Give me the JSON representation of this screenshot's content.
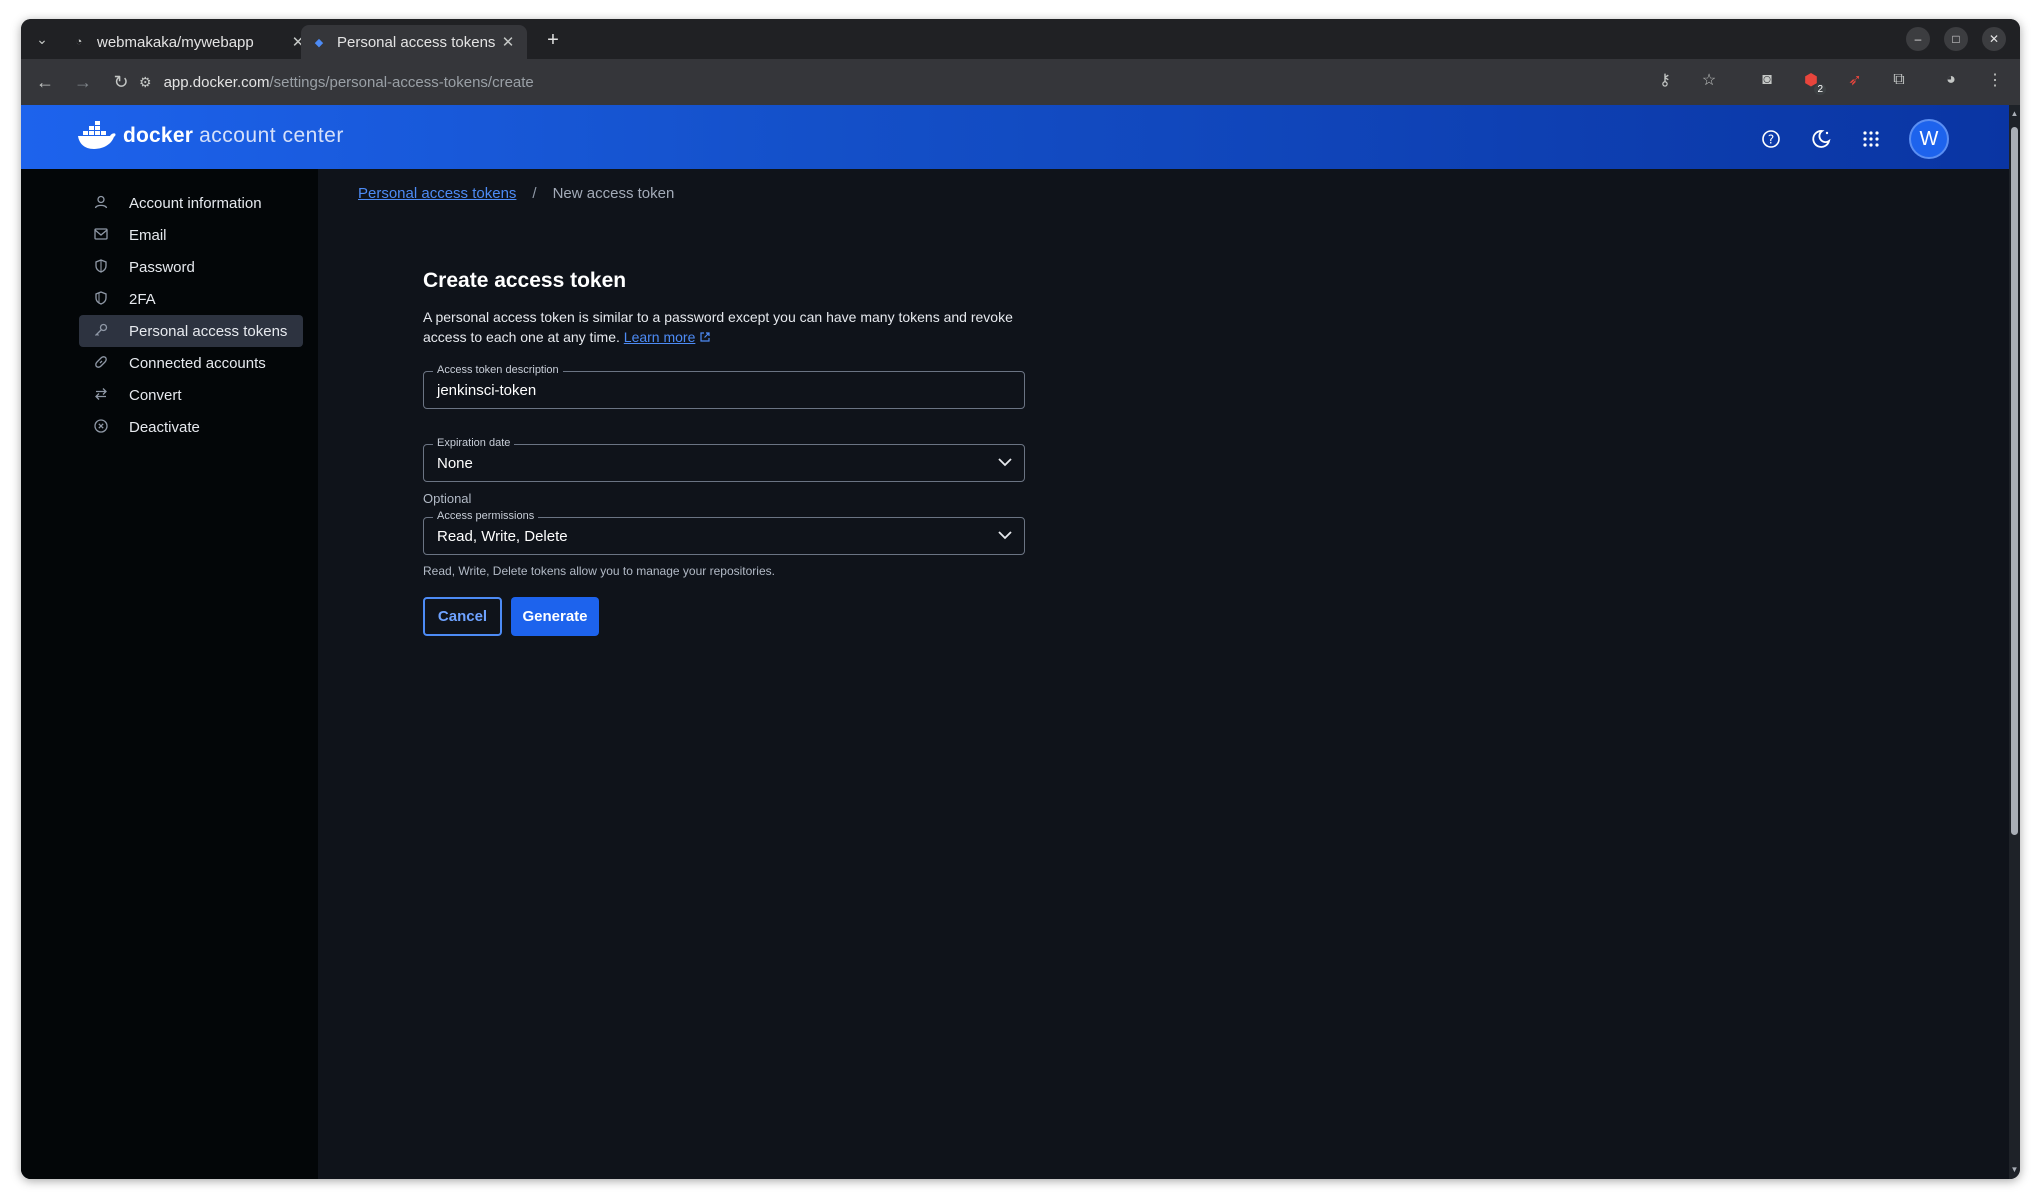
{
  "browser": {
    "tabs": [
      {
        "title": "webmakaka/mywebapp",
        "active": false
      },
      {
        "title": "Personal access tokens |",
        "active": true
      }
    ],
    "url_host": "app.docker.com",
    "url_path": "/settings/personal-access-tokens/create",
    "extension_badge": "2"
  },
  "header": {
    "brand_primary": "docker",
    "brand_secondary": "account center",
    "avatar_initial": "W"
  },
  "sidebar": {
    "items": [
      {
        "label": "Account information",
        "icon": "user-icon"
      },
      {
        "label": "Email",
        "icon": "mail-icon"
      },
      {
        "label": "Password",
        "icon": "shield-icon"
      },
      {
        "label": "2FA",
        "icon": "shield-check-icon"
      },
      {
        "label": "Personal access tokens",
        "icon": "key-icon",
        "active": true
      },
      {
        "label": "Connected accounts",
        "icon": "link-icon"
      },
      {
        "label": "Convert",
        "icon": "swap-icon"
      },
      {
        "label": "Deactivate",
        "icon": "x-circle-icon"
      }
    ]
  },
  "breadcrumb": {
    "parent": "Personal access tokens",
    "separator": "/",
    "current": "New access token"
  },
  "form": {
    "title": "Create access token",
    "description": "A personal access token is similar to a password except you can have many tokens and revoke access to each one at any time.",
    "learn_more": "Learn more",
    "description_label": "Access token description",
    "description_value": "jenkinsci-token",
    "expiration_label": "Expiration date",
    "expiration_value": "None",
    "optional_text": "Optional",
    "permissions_label": "Access permissions",
    "permissions_value": "Read, Write, Delete",
    "permissions_helper": "Read, Write, Delete tokens allow you to manage your repositories.",
    "cancel_label": "Cancel",
    "generate_label": "Generate"
  },
  "colors": {
    "accent": "#1d63ed",
    "background": "#0f131a",
    "sidebar": "#030608"
  }
}
